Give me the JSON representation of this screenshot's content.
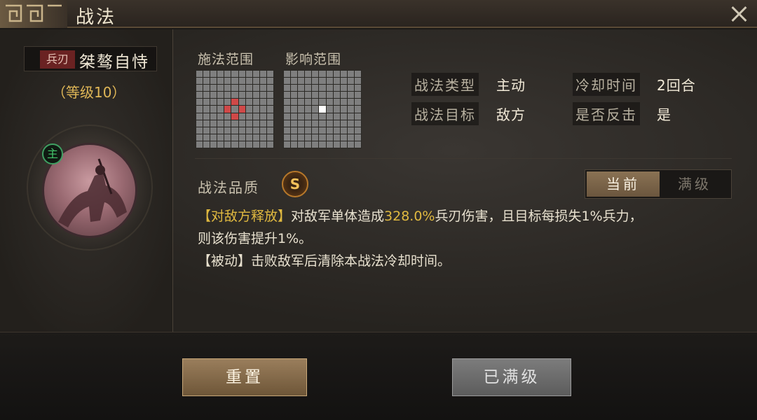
{
  "window": {
    "title": "战法"
  },
  "skill": {
    "type_tag": "兵刃",
    "name": "桀骜自恃",
    "level_text": "（等级10）",
    "main_badge": "主"
  },
  "grids": {
    "cast_label": "施法范围",
    "effect_label": "影响范围",
    "size": 11,
    "cast_cells": [
      [
        4,
        5
      ],
      [
        5,
        4
      ],
      [
        5,
        6
      ],
      [
        6,
        5
      ]
    ],
    "effect_cells": [
      [
        5,
        5
      ]
    ]
  },
  "info": {
    "type_label": "战法类型",
    "type_value": "主动",
    "cooldown_label": "冷却时间",
    "cooldown_value": "2回合",
    "target_label": "战法目标",
    "target_value": "敌方",
    "counter_label": "是否反击",
    "counter_value": "是"
  },
  "quality": {
    "label": "战法品质",
    "grade": "S"
  },
  "toggle": {
    "current": "当前",
    "max": "满级"
  },
  "description": {
    "line1_tag": "【对敌方释放】",
    "line1_a": "对敌军单体造成",
    "line1_value": "328.0%",
    "line1_b": "兵刃伤害，且目标每损失1%兵力，",
    "line2": "则该伤害提升1%。",
    "line3": "【被动】击败敌军后清除本战法冷却时间。"
  },
  "buttons": {
    "reset": "重置",
    "maxed": "已满级"
  },
  "colors": {
    "highlight": "#e0b940",
    "red_cell": "#d04848",
    "accent_green": "#43c56b"
  }
}
